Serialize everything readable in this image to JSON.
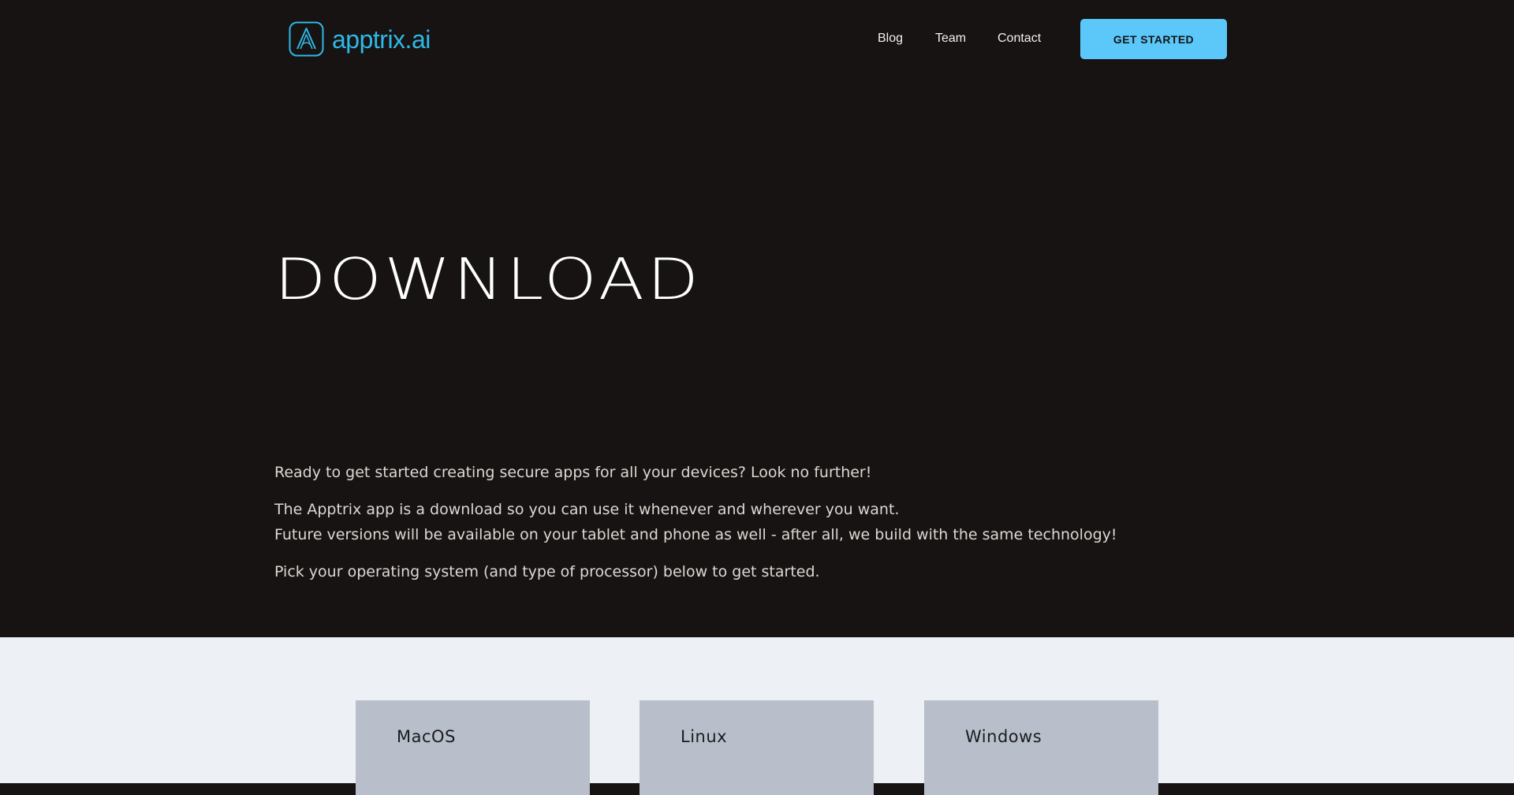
{
  "header": {
    "brand": "apptrix.ai",
    "nav": [
      {
        "label": "Blog"
      },
      {
        "label": "Team"
      },
      {
        "label": "Contact"
      }
    ],
    "cta_label": "GET STARTED"
  },
  "hero": {
    "title": "DOWNLOAD",
    "paragraphs": {
      "p1": "Ready to get started creating secure apps for all your devices? Look no further!",
      "p2_line1": "The Apptrix app is a download so you can use it whenever and wherever you want.",
      "p2_line2": "Future versions will be available on your tablet and phone as well - after all, we build with the same technology!",
      "p3": "Pick your operating system (and type of processor) below to get started."
    }
  },
  "downloads": [
    {
      "label": "MacOS"
    },
    {
      "label": "Linux"
    },
    {
      "label": "Windows"
    }
  ],
  "colors": {
    "background_dark": "#161312",
    "brand_accent": "#2fb9e8",
    "cta_background": "#5cc8fa",
    "lower_background": "#edf0f5",
    "card_background": "#b8bfca"
  },
  "icons": {
    "logo": "apptrix-a-logo-icon"
  }
}
